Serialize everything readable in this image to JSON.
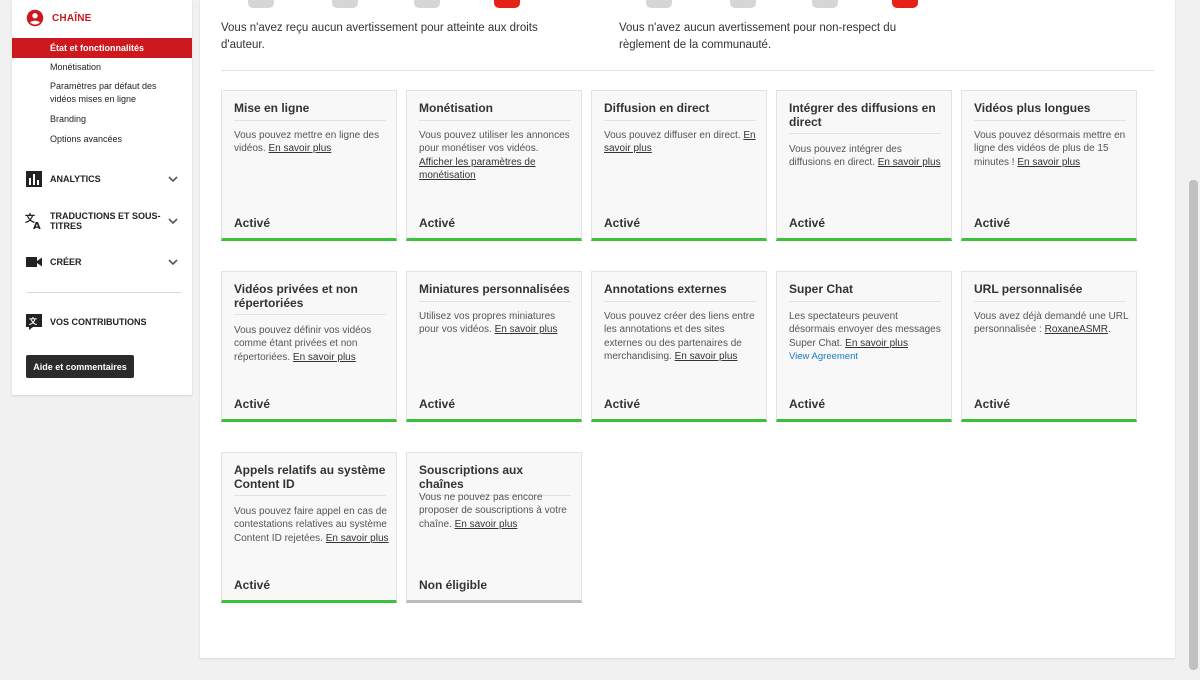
{
  "sidebar": {
    "channel_label": "CHAÎNE",
    "sub_items": [
      {
        "label": "État et fonctionnalités"
      },
      {
        "label": "Monétisation"
      },
      {
        "label": "Paramètres par défaut des vidéos mises en ligne"
      },
      {
        "label": "Branding"
      },
      {
        "label": "Options avancées"
      }
    ],
    "analytics_label": "ANALYTICS",
    "translations_label": "TRADUCTIONS ET SOUS-TITRES",
    "create_label": "CRÉER",
    "contributions_label": "VOS CONTRIBUTIONS",
    "help_label": "Aide et commentaires"
  },
  "notices": {
    "copyright": "Vous n'avez reçu aucun avertissement pour atteinte aux droits d'auteur.",
    "community": "Vous n'avez aucun avertissement pour non-respect du règlement de la communauté."
  },
  "colors": {
    "accent_red": "#cc181e",
    "enabled_green": "#3cc13c",
    "link_blue": "#167ac6"
  },
  "cards": [
    {
      "title": "Mise en ligne",
      "body": "Vous pouvez mettre en ligne des vidéos.",
      "link": "En savoir plus",
      "status": "Activé"
    },
    {
      "title": "Monétisation",
      "body": "Vous pouvez utiliser les annonces pour monétiser vos vidéos.",
      "link": "Afficher les paramètres de monétisation",
      "status": "Activé"
    },
    {
      "title": "Diffusion en direct",
      "body": "Vous pouvez diffuser en direct.",
      "link": "En savoir plus",
      "status": "Activé"
    },
    {
      "title": "Intégrer des diffusions en direct",
      "body": "Vous pouvez intégrer des diffusions en direct.",
      "link": "En savoir plus",
      "status": "Activé"
    },
    {
      "title": "Vidéos plus longues",
      "body": "Vous pouvez désormais mettre en ligne des vidéos de plus de 15 minutes !",
      "link": "En savoir plus",
      "status": "Activé"
    },
    {
      "title": "Vidéos privées et non répertoriées",
      "body": "Vous pouvez définir vos vidéos comme étant privées et non répertoriées.",
      "link": "En savoir plus",
      "status": "Activé"
    },
    {
      "title": "Miniatures personnalisées",
      "body": "Utilisez vos propres miniatures pour vos vidéos.",
      "link": "En savoir plus",
      "status": "Activé"
    },
    {
      "title": "Annotations externes",
      "body": "Vous pouvez créer des liens entre les annotations et des sites externes ou des partenaires de merchandising.",
      "link": "En savoir plus",
      "status": "Activé"
    },
    {
      "title": "Super Chat",
      "body": "Les spectateurs peuvent désormais envoyer des messages Super Chat.",
      "link": "En savoir plus",
      "extra_link": "View Agreement",
      "status": "Activé"
    },
    {
      "title": "URL personnalisée",
      "body": "Vous avez déjà demandé une URL personnalisée :",
      "link": "RoxaneASMR",
      "suffix": ".",
      "status": "Activé"
    },
    {
      "title": "Appels relatifs au système Content ID",
      "body": "Vous pouvez faire appel en cas de contestations relatives au système Content ID rejetées.",
      "link": "En savoir plus",
      "status": "Activé"
    },
    {
      "title": "Souscriptions aux chaînes",
      "body": "Vous ne pouvez pas encore proposer de souscriptions à votre chaîne.",
      "link": "En savoir plus",
      "status": "Non éligible"
    }
  ]
}
